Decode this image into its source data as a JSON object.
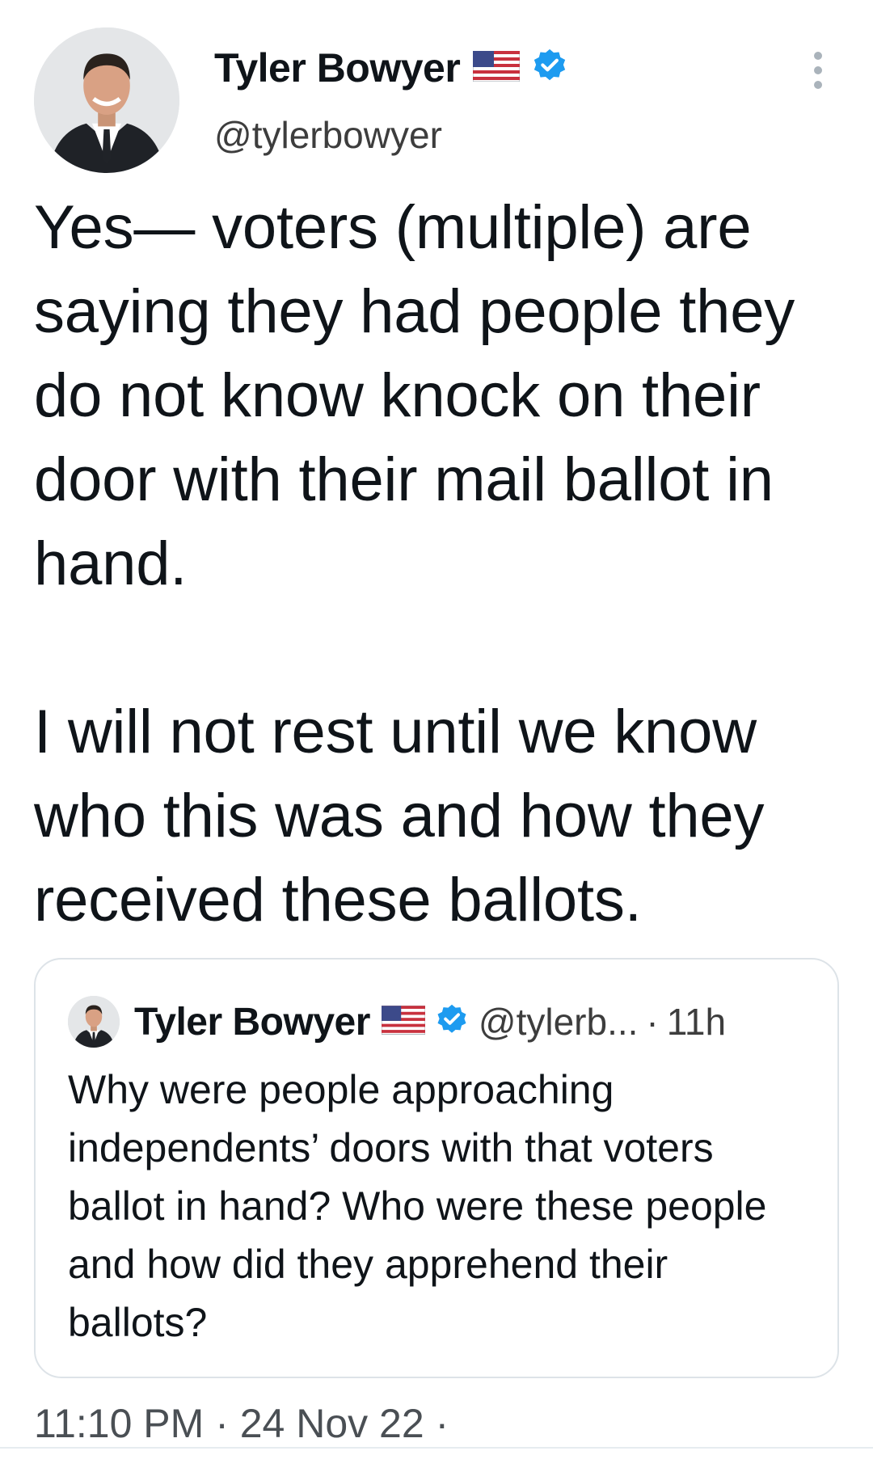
{
  "author": {
    "display_name": "Tyler Bowyer",
    "handle": "@tylerbowyer",
    "flag_icon": "us-flag-icon",
    "verified_icon": "verified-badge-icon"
  },
  "tweet": {
    "paragraphs": [
      "Yes— voters (multiple) are saying they had people they do not know knock on their door with their mail ballot in hand.",
      "I will not rest until we know who this was and how they received these ballots."
    ],
    "timestamp": "11:10 PM · 24 Nov 22 ·"
  },
  "quoted_tweet": {
    "display_name": "Tyler Bowyer",
    "handle": "@tylerb...",
    "separator": "·",
    "time": "11h",
    "text": "Why were people approaching independents’ doors with that voters ballot in hand? Who were these people and how did they apprehend their ballots?"
  },
  "colors": {
    "text": "#0f1419",
    "secondary": "#3d3d3d",
    "verified": "#1d9bf0",
    "border": "#dde3e8"
  }
}
